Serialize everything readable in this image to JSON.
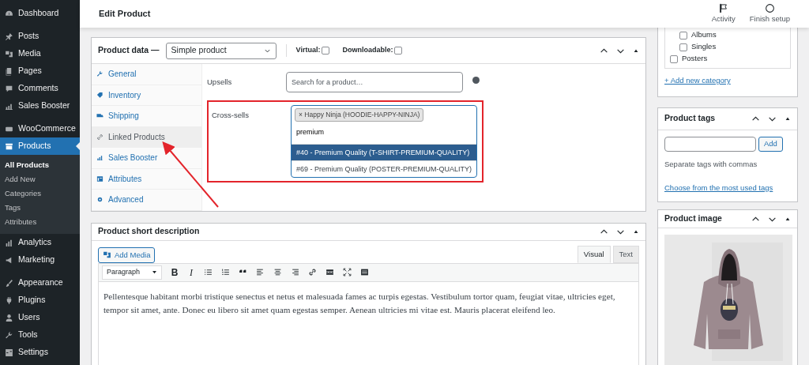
{
  "sidebar": {
    "groups": [
      [
        {
          "label": "Dashboard",
          "selected": false
        }
      ],
      [
        {
          "label": "Posts",
          "selected": false
        },
        {
          "label": "Media",
          "selected": false
        },
        {
          "label": "Pages",
          "selected": false
        },
        {
          "label": "Comments",
          "selected": false
        },
        {
          "label": "Sales Booster",
          "selected": false
        }
      ],
      [
        {
          "label": "WooCommerce",
          "selected": false
        },
        {
          "label": "Products",
          "selected": true,
          "children": [
            {
              "label": "All Products",
              "selected": true
            },
            {
              "label": "Add New",
              "selected": false
            },
            {
              "label": "Categories",
              "selected": false
            },
            {
              "label": "Tags",
              "selected": false
            },
            {
              "label": "Attributes",
              "selected": false
            }
          ]
        },
        {
          "label": "Analytics",
          "selected": false
        },
        {
          "label": "Marketing",
          "selected": false
        }
      ],
      [
        {
          "label": "Appearance",
          "selected": false
        },
        {
          "label": "Plugins",
          "selected": false
        },
        {
          "label": "Users",
          "selected": false
        },
        {
          "label": "Tools",
          "selected": false
        },
        {
          "label": "Settings",
          "selected": false
        }
      ]
    ]
  },
  "header": {
    "title": "Edit Product",
    "actions": [
      {
        "label": "Activity"
      },
      {
        "label": "Finish setup"
      }
    ]
  },
  "product_data": {
    "title": "Product data —",
    "type": "Simple product",
    "options": [
      {
        "label": "Virtual:",
        "checked": false
      },
      {
        "label": "Downloadable:",
        "checked": false
      }
    ],
    "tabs": [
      {
        "label": "General",
        "selected": false
      },
      {
        "label": "Inventory",
        "selected": false
      },
      {
        "label": "Shipping",
        "selected": false
      },
      {
        "label": "Linked Products",
        "selected": true
      },
      {
        "label": "Sales Booster",
        "selected": false
      },
      {
        "label": "Attributes",
        "selected": false
      },
      {
        "label": "Advanced",
        "selected": false
      }
    ],
    "upsells": {
      "label": "Upsells",
      "placeholder": "Search for a product…"
    },
    "cross_sells": {
      "label": "Cross-sells",
      "tokens": [
        "× Happy Ninja (HOODIE-HAPPY-NINJA)"
      ],
      "value": "premium",
      "results": [
        {
          "label": "#40 - Premium Quality (T-SHIRT-PREMIUM-QUALITY)",
          "selected": true
        },
        {
          "label": "#69 - Premium Quality (POSTER-PREMIUM-QUALITY)",
          "selected": false
        }
      ]
    }
  },
  "short_description": {
    "title": "Product short description",
    "add_media": "Add Media",
    "editor_tabs": [
      {
        "label": "Visual",
        "selected": true
      },
      {
        "label": "Text",
        "selected": false
      }
    ],
    "toolbar": {
      "format": "Paragraph",
      "bold": "B",
      "italic": "I"
    },
    "text": "Pellentesque habitant morbi tristique senectus et netus et malesuada fames ac turpis egestas. Vestibulum tortor quam, feugiat vitae, ultricies eget, tempor sit amet, ante. Donec eu libero sit amet quam egestas semper. Aenean ultricies mi vitae est. Mauris placerat eleifend leo."
  },
  "categories": {
    "items": [
      {
        "children": [
          {
            "label": "Albums",
            "checked": false
          },
          {
            "label": "Singles",
            "checked": false
          }
        ]
      },
      {
        "label": "Posters",
        "checked": false
      }
    ],
    "add_link": "+ Add new category"
  },
  "tags": {
    "title": "Product tags",
    "button": "Add",
    "hint": "Separate tags with commas",
    "link": "Choose from the most used tags"
  },
  "image": {
    "title": "Product image",
    "kind": "picture"
  }
}
